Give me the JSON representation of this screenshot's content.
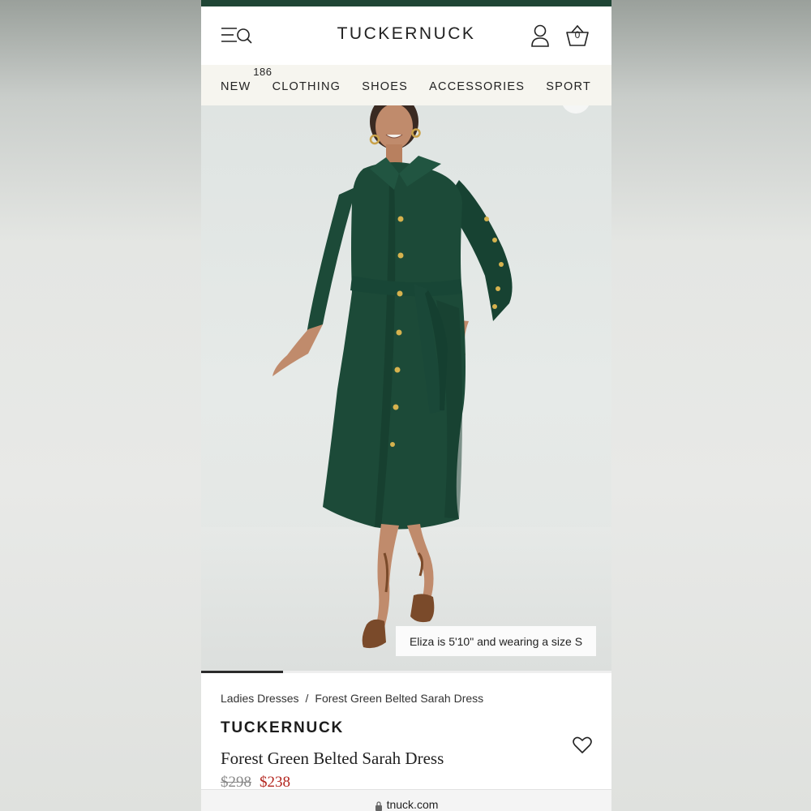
{
  "header": {
    "logo": "TUCKERNUCK",
    "bag_count": "0"
  },
  "nav": {
    "items": [
      {
        "label": "NEW",
        "badge": "186"
      },
      {
        "label": "CLOTHING"
      },
      {
        "label": "SHOES"
      },
      {
        "label": "ACCESSORIES"
      },
      {
        "label": "SPORT"
      }
    ]
  },
  "hero": {
    "caption": "Eliza is 5'10\" and wearing a size S",
    "carousel_progress": 0.2
  },
  "product": {
    "breadcrumb": {
      "parent": "Ladies Dresses",
      "separator": "/",
      "current": "Forest Green Belted Sarah Dress"
    },
    "brand": "TUCKERNUCK",
    "title": "Forest Green Belted Sarah Dress",
    "original_price": "$298",
    "sale_price": "$238"
  },
  "browser": {
    "url": "tnuck.com"
  },
  "colors": {
    "brand_green": "#1f4535",
    "dress_green": "#1c4a38",
    "sale_red": "#b3251e",
    "nav_bg": "#f6f5ef"
  }
}
